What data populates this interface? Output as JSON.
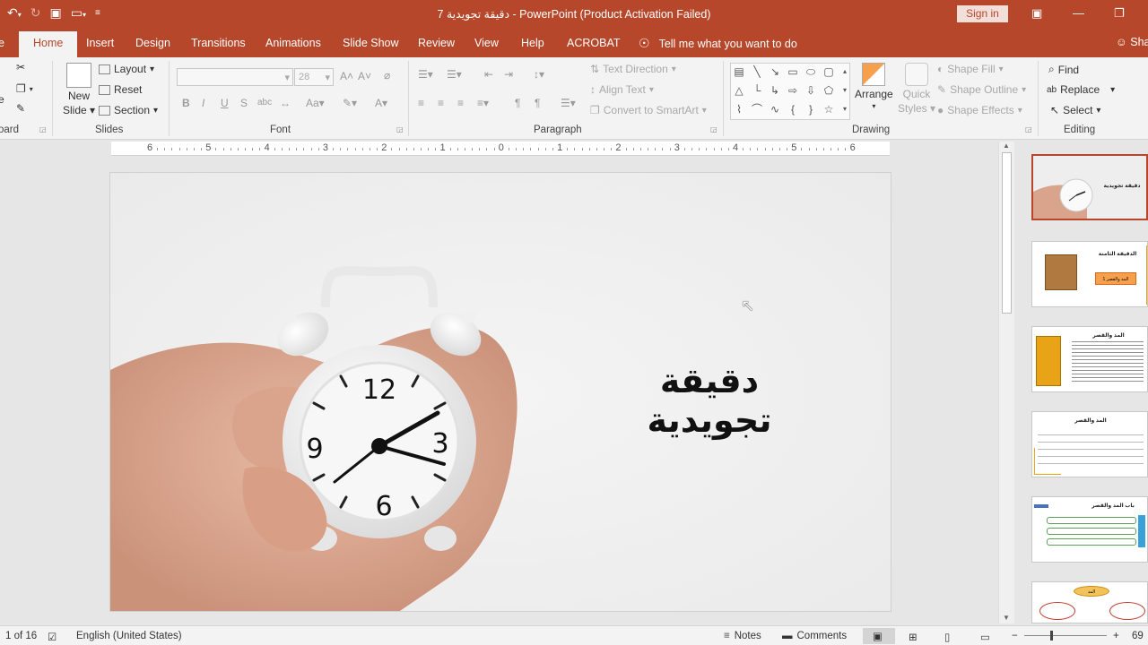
{
  "window": {
    "title": "7 دقيقة تجويدية  -  PowerPoint (Product Activation Failed)",
    "signin_label": "Sign in"
  },
  "tabs": [
    {
      "label": "e"
    },
    {
      "label": "Home"
    },
    {
      "label": "Insert"
    },
    {
      "label": "Design"
    },
    {
      "label": "Transitions"
    },
    {
      "label": "Animations"
    },
    {
      "label": "Slide Show"
    },
    {
      "label": "Review"
    },
    {
      "label": "View"
    },
    {
      "label": "Help"
    },
    {
      "label": "ACROBAT"
    }
  ],
  "tell_me": "Tell me what you want to do",
  "share_label": "Sha",
  "ribbon": {
    "clipboard_label": "oard",
    "clipboard_paste_partial": "e",
    "slides": {
      "label": "Slides",
      "new_slide": "New",
      "new_slide_2": "Slide",
      "layout": "Layout",
      "reset": "Reset",
      "section": "Section"
    },
    "font": {
      "label": "Font",
      "size": "28"
    },
    "paragraph": {
      "label": "Paragraph",
      "text_direction": "Text Direction",
      "align_text": "Align Text",
      "convert_smartart": "Convert to SmartArt"
    },
    "drawing": {
      "label": "Drawing",
      "arrange": "Arrange",
      "quick_styles": "Quick",
      "quick_styles_2": "Styles",
      "shape_fill": "Shape Fill",
      "shape_outline": "Shape Outline",
      "shape_effects": "Shape Effects"
    },
    "editing": {
      "label": "Editing",
      "find": "Find",
      "replace": "Replace",
      "select": "Select"
    }
  },
  "ruler_numbers": [
    "6",
    "5",
    "4",
    "3",
    "2",
    "1",
    "0",
    "1",
    "2",
    "3",
    "4",
    "5",
    "6"
  ],
  "slide": {
    "title": "دقيقة تجويدية",
    "clock_numbers": [
      "12",
      "3",
      "6",
      "9"
    ]
  },
  "thumbnails": [
    {
      "title": "دقيقة تجويدية"
    },
    {
      "title": "الدقيقة الثامنة",
      "box": "المد والقصر 1"
    },
    {
      "title": "المد والقصر"
    },
    {
      "title": "المد والقصر"
    },
    {
      "title": "باب المد والقصر"
    },
    {
      "title": "المد"
    }
  ],
  "status": {
    "slide_count": "1 of 16",
    "language": "English (United States)",
    "notes": "Notes",
    "comments": "Comments",
    "zoom": "69"
  },
  "colors": {
    "accent": "#b7472a",
    "thumb_gold": "#e8a317",
    "thumb_orange": "#f6a04d"
  }
}
